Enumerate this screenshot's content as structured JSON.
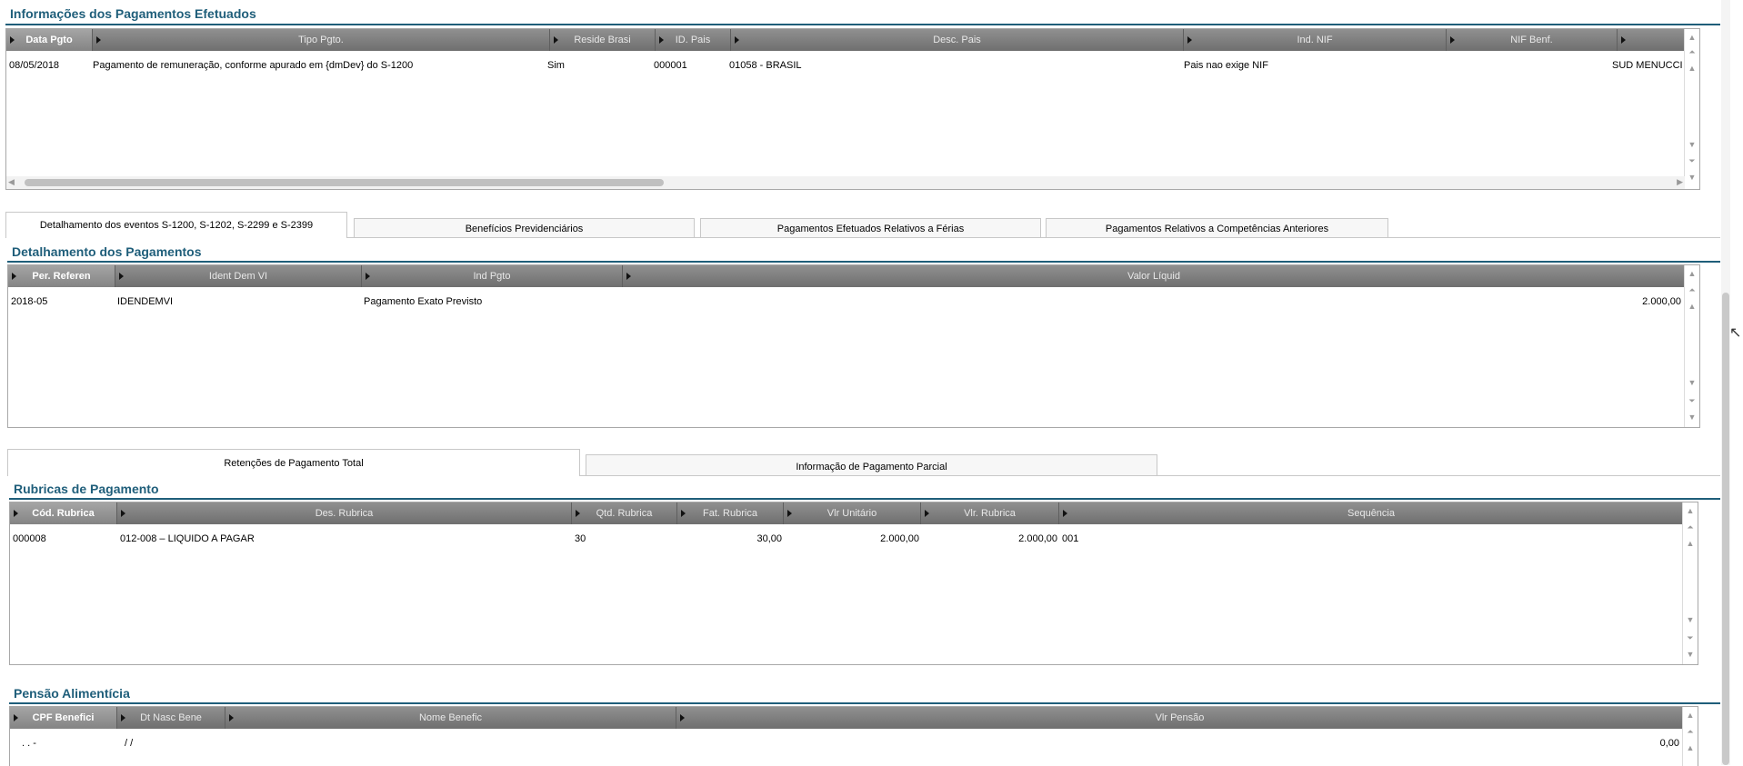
{
  "pagamentos": {
    "title": "Informações dos Pagamentos Efetuados",
    "columns": [
      "Data Pgto",
      "Tipo Pgto.",
      "Reside Brasi",
      "ID. Pais",
      "Desc. Pais",
      "Ind. NIF",
      "NIF Benf.",
      ""
    ],
    "row": {
      "data_pgto": "08/05/2018",
      "tipo_pgto": "Pagamento de remuneração, conforme apurado em {dmDev} do S-1200",
      "reside_brasil": "Sim",
      "id_pais": "000001",
      "desc_pais": "01058 - BRASIL",
      "ind_nif": "Pais nao exige NIF",
      "nif_benf": "",
      "extra": "SUD MENUCCI"
    }
  },
  "tabs_main": [
    {
      "label": "Detalhamento dos eventos S-1200, S-1202, S-2299 e S-2399",
      "active": true
    },
    {
      "label": "Benefícios Previdenciários",
      "active": false
    },
    {
      "label": "Pagamentos Efetuados Relativos a Férias",
      "active": false
    },
    {
      "label": "Pagamentos Relativos a Competências Anteriores",
      "active": false
    }
  ],
  "detalhamento": {
    "title": "Detalhamento dos Pagamentos",
    "columns": [
      "Per. Referen",
      "Ident Dem VI",
      "Ind Pgto",
      "Valor Líquid"
    ],
    "row": {
      "per_referen": "2018-05",
      "ident_dem": "IDENDEMVI",
      "ind_pgto": "Pagamento Exato Previsto",
      "valor_liquido": "2.000,00"
    }
  },
  "tabs_sub": [
    {
      "label": "Retenções de Pagamento Total",
      "active": true
    },
    {
      "label": "Informação de Pagamento Parcial",
      "active": false
    }
  ],
  "rubricas": {
    "title": "Rubricas de Pagamento",
    "columns": [
      "Cód. Rubrica",
      "Des. Rubrica",
      "Qtd. Rubrica",
      "Fat. Rubrica",
      "Vlr Unitário",
      "Vlr. Rubrica",
      "Sequência"
    ],
    "row": {
      "cod": "000008",
      "des": "012-008 – LIQUIDO A PAGAR",
      "qtd": "30",
      "fat": "30,00",
      "vlr_unit": "2.000,00",
      "vlr_rubrica": "2.000,00",
      "seq": "001"
    }
  },
  "pensao": {
    "title": "Pensão Alimentícia",
    "columns": [
      "CPF Benefici",
      "Dt Nasc Bene",
      "Nome Benefic",
      "Vlr Pensão"
    ],
    "row": {
      "cpf": ".  .  -",
      "dt_nasc": "/  /",
      "nome": "",
      "vlr": "0,00"
    }
  },
  "colors": {
    "title": "#1f5e7a",
    "header_bg": "#7d7d7d",
    "header_first_bg": "#959595"
  },
  "icons": [
    "expand-arrow-icon",
    "scroll-up-icon",
    "scroll-down-icon",
    "scroll-top-icon",
    "scroll-bottom-icon",
    "scroll-left-icon",
    "scroll-right-icon"
  ]
}
